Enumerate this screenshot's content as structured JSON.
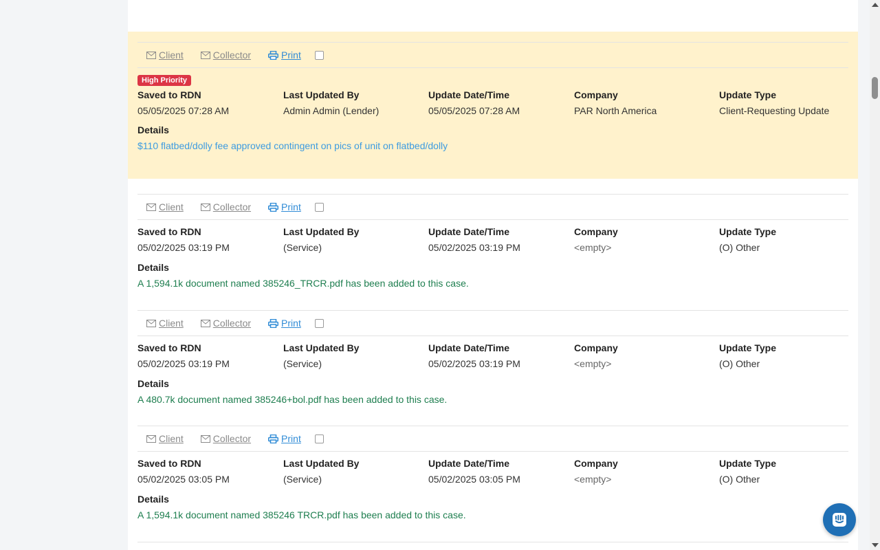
{
  "labels": {
    "saved": "Saved to RDN",
    "updated_by": "Last Updated By",
    "update_dt": "Update Date/Time",
    "company": "Company",
    "update_type": "Update Type",
    "details": "Details"
  },
  "actions": {
    "client": "Client",
    "collector": "Collector",
    "print": "Print"
  },
  "colors": {
    "priority_bg": "#fff2cc",
    "badge": "#dc3545",
    "link_blue": "#2f8bd6",
    "detail_green": "#1e7e4f",
    "chat": "#1f6fb5"
  },
  "entries": [
    {
      "badge": "High Priority",
      "saved": "05/05/2025 07:28 AM",
      "updated_by": "Admin Admin (Lender)",
      "update_dt": "05/05/2025 07:28 AM",
      "company": "PAR North America",
      "update_type": "Client-Requesting Update",
      "details": "$110 flatbed/dolly fee approved contingent on pics of unit on flatbed/dolly"
    },
    {
      "saved": "05/02/2025 03:19 PM",
      "updated_by": "(Service)",
      "update_dt": "05/02/2025 03:19 PM",
      "company": "<empty>",
      "update_type": "(O) Other",
      "details": "A 1,594.1k document named 385246_TRCR.pdf has been added to this case."
    },
    {
      "saved": "05/02/2025 03:19 PM",
      "updated_by": "(Service)",
      "update_dt": "05/02/2025 03:19 PM",
      "company": "<empty>",
      "update_type": "(O) Other",
      "details": "A 480.7k document named 385246+bol.pdf has been added to this case."
    },
    {
      "saved": "05/02/2025 03:05 PM",
      "updated_by": "(Service)",
      "update_dt": "05/02/2025 03:05 PM",
      "company": "<empty>",
      "update_type": "(O) Other",
      "details": "A 1,594.1k document named 385246 TRCR.pdf has been added to this case."
    }
  ]
}
